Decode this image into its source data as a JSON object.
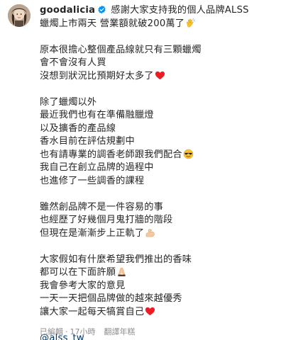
{
  "post": {
    "username": "goodalicia",
    "first_line_text": "感謝大家支持我的個人品牌ALSS",
    "lines": {
      "l1": "蠟燭上市兩天 營業額就破200萬了",
      "l3": "原本很擔心整個產品線就只有三顆蠟燭",
      "l4": "會不會沒有人買",
      "l5": "沒想到狀況比預期好太多了",
      "l7": "除了蠟燭以外",
      "l8": "最近我們也有在準備融臘燈",
      "l9": "以及擴香的產品線",
      "l10": "香水目前在評估規劃中",
      "l11": "也有請專業的調香老師跟我們配合",
      "l12": "我自己在創立品牌的過程中",
      "l13": "也進修了一些調香的課程",
      "l15": "雖然創品牌不是一件容易的事",
      "l16": "也經歷了好幾個月鬼打牆的階段",
      "l17": "但現在是漸漸步上正軌了",
      "l19": "大家假如有什麼希望我們推出的香味",
      "l20": "都可以在下面許願",
      "l21": "我會參考大家的意見",
      "l22": "一天一天把個品牌做的越來越優秀",
      "l23": "讓大家一起每天犒賞自己"
    },
    "mention": "@alss_tw",
    "edited": "已編輯",
    "separator": "·",
    "time_ago": "17小時",
    "see_translation": "翻譯年糕"
  },
  "colors": {
    "verified_badge": "#0095f6",
    "mention_link": "#00376b",
    "meta_text": "#8e8e8e",
    "heart": "#ed1c24"
  },
  "icons": {
    "verified": "verified-badge-icon",
    "clap": "clapping-hands-emoji-icon",
    "heart": "red-heart-emoji-icon",
    "sunglasses": "sunglasses-face-emoji-icon",
    "muscle": "flexed-biceps-emoji-icon",
    "pray": "folded-hands-emoji-icon"
  }
}
